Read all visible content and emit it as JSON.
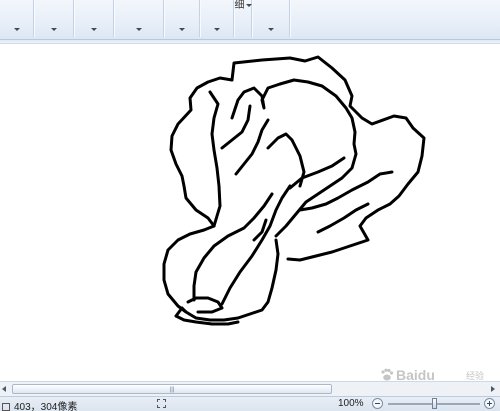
{
  "ribbon": {
    "groups": [
      {
        "label": ""
      },
      {
        "label": ""
      },
      {
        "label": ""
      },
      {
        "label": ""
      },
      {
        "label": ""
      },
      {
        "label": ""
      },
      {
        "label": "细"
      },
      {
        "label": ""
      }
    ]
  },
  "canvas": {
    "subject": "bok-choy-sketch",
    "stroke_color": "#000000"
  },
  "statusbar": {
    "cursor_position": "403，304像素",
    "zoom_level": "100%",
    "zoom_fraction": 0.5
  },
  "watermark": {
    "brand": "Baidu",
    "sub": "经验"
  },
  "colors": {
    "ribbon_bg": "#e8eff8",
    "statusbar_bg": "#dbe4ef",
    "canvas_bg": "#ffffff"
  }
}
